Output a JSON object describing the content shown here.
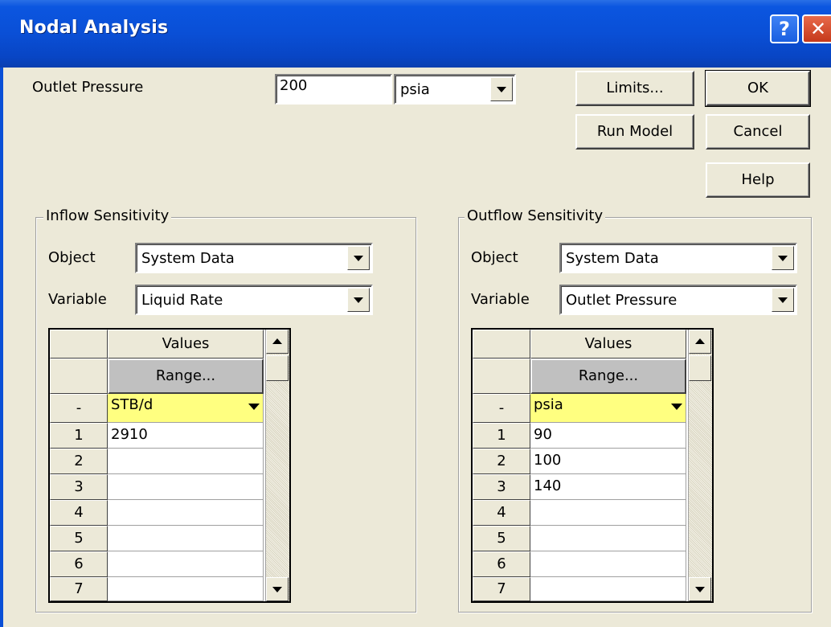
{
  "window": {
    "title": "Nodal Analysis",
    "help_glyph": "?",
    "close_glyph": "✕"
  },
  "outlet": {
    "label": "Outlet Pressure",
    "value": "200",
    "unit": "psia"
  },
  "buttons": {
    "limits": "Limits...",
    "ok": "OK",
    "run_model": "Run Model",
    "cancel": "Cancel",
    "help": "Help"
  },
  "inflow": {
    "title": "Inflow Sensitivity",
    "object_label": "Object",
    "object_value": "System Data",
    "variable_label": "Variable",
    "variable_value": "Liquid Rate",
    "grid": {
      "header": "Values",
      "range_button": "Range...",
      "unit_row_label": "-",
      "unit": "STB/d",
      "rows": [
        {
          "num": "1",
          "val": "2910"
        },
        {
          "num": "2",
          "val": ""
        },
        {
          "num": "3",
          "val": ""
        },
        {
          "num": "4",
          "val": ""
        },
        {
          "num": "5",
          "val": ""
        },
        {
          "num": "6",
          "val": ""
        },
        {
          "num": "7",
          "val": ""
        }
      ]
    }
  },
  "outflow": {
    "title": "Outflow Sensitivity",
    "object_label": "Object",
    "object_value": "System Data",
    "variable_label": "Variable",
    "variable_value": "Outlet Pressure",
    "grid": {
      "header": "Values",
      "range_button": "Range...",
      "unit_row_label": "-",
      "unit": "psia",
      "rows": [
        {
          "num": "1",
          "val": "90"
        },
        {
          "num": "2",
          "val": "100"
        },
        {
          "num": "3",
          "val": "140"
        },
        {
          "num": "4",
          "val": ""
        },
        {
          "num": "5",
          "val": ""
        },
        {
          "num": "6",
          "val": ""
        },
        {
          "num": "7",
          "val": ""
        }
      ]
    }
  },
  "colors": {
    "titlebar": "#0a4fd6",
    "dialog_bg": "#ece9d8",
    "unit_cell": "#ffff80"
  }
}
